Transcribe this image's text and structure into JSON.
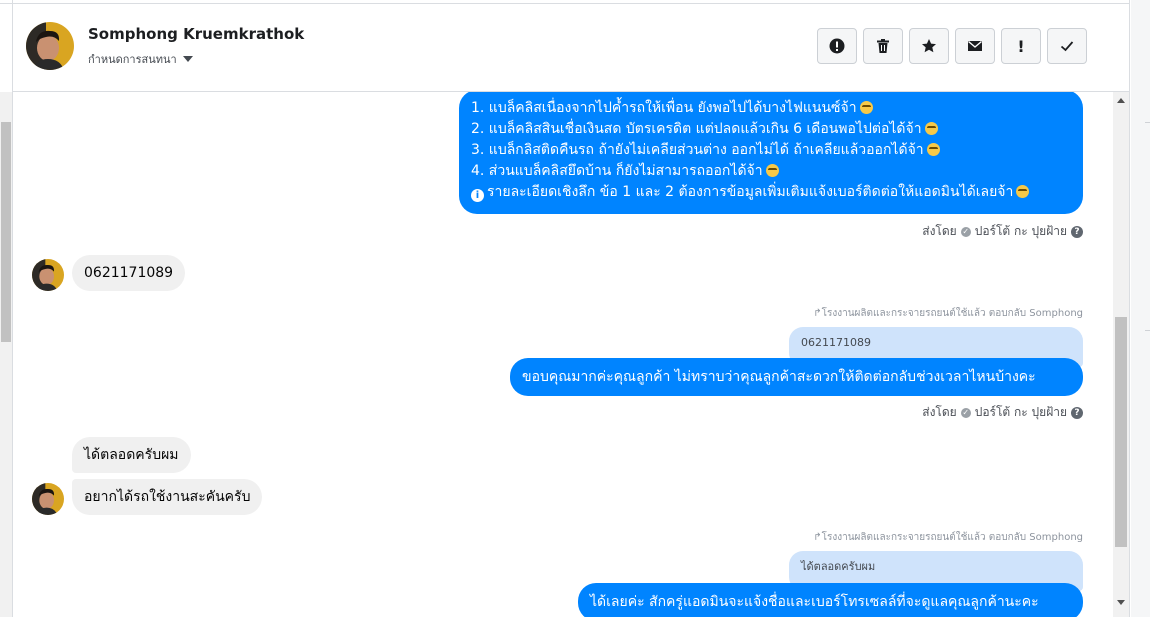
{
  "header": {
    "name": "Somphong Kruemkrathok",
    "subtitle": "กำหนดการสนทนา"
  },
  "toolbar": {
    "buttons": [
      {
        "icon": "alert-circle-icon",
        "glyph": "●"
      },
      {
        "icon": "trash-icon",
        "glyph": "🗑"
      },
      {
        "icon": "star-icon",
        "glyph": "★"
      },
      {
        "icon": "envelope-icon",
        "glyph": "✉"
      },
      {
        "icon": "exclamation-icon",
        "glyph": "!"
      },
      {
        "icon": "check-icon",
        "glyph": "✓"
      }
    ]
  },
  "messages": {
    "first_out": {
      "line1": "1. แบล็คลิสเนื่องจากไปค้ำรถให้เพื่อน ยังพอไปได้บางไฟแนนซ์จ้า",
      "line2": "2. แบล็คลิสสินเชื่อเงินสด บัตรเครดิต แต่ปลดแล้วเกิน 6 เดือนพอไปต่อได้จ้า",
      "line3": "3. แบล็กลิสติดคืนรถ ถ้ายังไม่เคลียส่วนต่าง ออกไม่ได้ ถ้าเคลียแล้วออกได้จ้า",
      "line4": "4. ส่วนแบล็คลิสยึดบ้าน ก็ยังไม่สามารถออกได้จ้า",
      "line5": "รายละเอียดเชิงลึก ข้อ 1 และ 2 ต้องการข้อมูลเพิ่มเติมแจ้งเบอร์ติดต่อให้แอดมินได้เลยจ้า"
    },
    "sent_by_1": "ส่งโดย",
    "sender_1": "ปอร์โต้ กะ ปุยฝ้าย",
    "in_phone": "0621171089",
    "reply_note_1": "โรงงานผลิตและกระจายรถยนต์ใช้แล้ว ตอบกลับ Somphong",
    "quote_1": "0621171089",
    "out_2": "ขอบคุณมากค่ะคุณลูกค้า ไม่ทราบว่าคุณลูกค้าสะดวกให้ติดต่อกลับช่วงเวลาไหนบ้างคะ",
    "sent_by_2": "ส่งโดย",
    "sender_2": "ปอร์โต้ กะ ปุยฝ้าย",
    "in_2": "ได้ตลอดครับผม",
    "in_3": "อยากได้รถใช้งานสะคันครับ",
    "reply_note_2": "โรงงานผลิตและกระจายรถยนต์ใช้แล้ว ตอบกลับ Somphong",
    "quote_2": "ได้ตลอดครับผม",
    "out_3": "ได้เลยค่ะ สักครู่แอดมินจะแจ้งชื่อและเบอร์โทรเซลล์ที่จะดูแลคุณลูกค้านะคะ"
  }
}
